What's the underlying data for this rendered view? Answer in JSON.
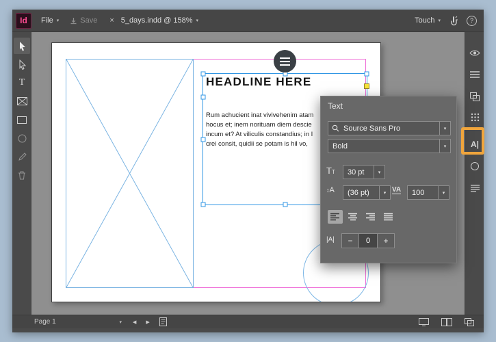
{
  "app": {
    "menubar": {
      "logo": "Id",
      "file": "File",
      "save": "Save",
      "tab": "5_days.indd @ 158%",
      "workspace": "Touch",
      "help": "?"
    },
    "statusbar": {
      "page": "Page 1"
    }
  },
  "canvas": {
    "headline": "HEADLINE HERE",
    "body": [
      "Rum achucient inat vivivehenim atam",
      "hocus et; inem norituam diem descie",
      "incum et? At viliculis constandius; in I",
      "crei consit, quidii se potam is hil vo,"
    ]
  },
  "panel": {
    "title": "Text",
    "font": "Source Sans Pro",
    "style": "Bold",
    "size": "30 pt",
    "leading": "(36 pt)",
    "tracking": "100",
    "baseline": "0",
    "minus": "−",
    "plus": "+"
  },
  "icons": {
    "caret": "▾",
    "close": "×",
    "type": "T",
    "size_big": "T",
    "size_small": "T",
    "leading_arrow": "↕",
    "leading_A": "A",
    "tracking_VA": "VA",
    "baseline_A": "|A|",
    "char_format": "A|",
    "left_arrow": "◀",
    "right_arrow": "▶"
  },
  "colors": {
    "accent_orange": "#F0A53C",
    "selection_blue": "#2F96E4",
    "margin_magenta": "#EF6FD8",
    "handle_yellow": "#F8E33C",
    "logo_pink": "#FF4D93"
  }
}
